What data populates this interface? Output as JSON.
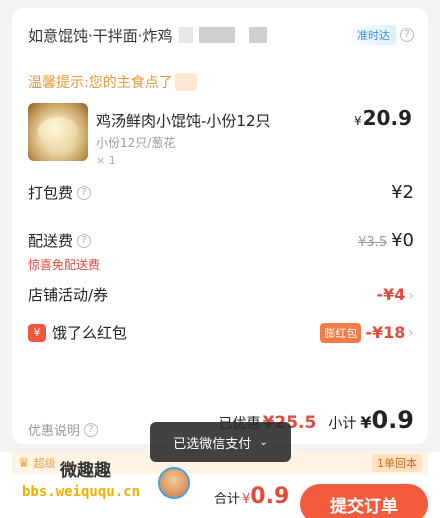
{
  "shop": {
    "name": "如意馄饨·干拌面·炸鸡",
    "ontime_badge": "准时达"
  },
  "tip": "温馨提示:您的主食点了",
  "item": {
    "name": "鸡汤鲜肉小馄饨-小份12只",
    "spec": "小份12只/葱花",
    "qty": "× 1",
    "price_symbol": "¥",
    "price": "20.9"
  },
  "packing_fee": {
    "label": "打包费",
    "value": "¥2"
  },
  "delivery_fee": {
    "label": "配送费",
    "original": "¥3.5",
    "value": "¥0",
    "note": "惊喜免配送费"
  },
  "store_promo": {
    "label": "店铺活动/券",
    "value": "-¥4"
  },
  "red_packet": {
    "icon_char": "¥",
    "label": "饿了么红包",
    "tag": "膨红包",
    "value": "-¥18"
  },
  "promo_explain": "优惠说明",
  "summary": {
    "discount_label": "已优惠",
    "discount_value": "¥25.5",
    "subtotal_label": "小计",
    "subtotal_symbol": "¥",
    "subtotal_value": "0.9"
  },
  "toast": {
    "text": "已选微信支付"
  },
  "bottom": {
    "upper_text": "超级",
    "back_tag": "1单回本",
    "watermark_logo": "微趣趣",
    "watermark_url": "bbs.weiququ.cn",
    "total_label": "合计",
    "total_symbol": "¥",
    "total_value": "0.9",
    "submit_label": "提交订单"
  },
  "colors": {
    "accent_red": "#e24a3c",
    "button": "#f25c3c",
    "tip_orange": "#e8983c",
    "ontime_blue": "#3a8bd8"
  }
}
